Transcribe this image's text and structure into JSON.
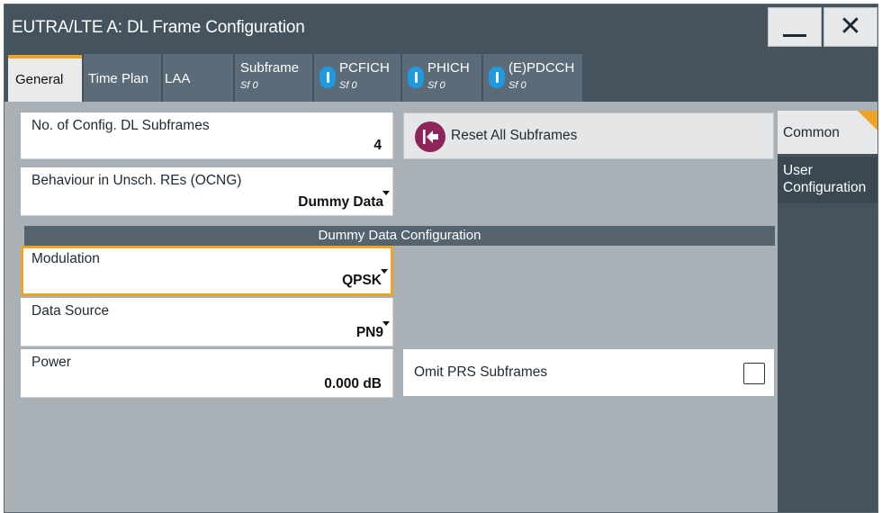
{
  "window": {
    "title": "EUTRA/LTE A: DL Frame Configuration",
    "minimize_icon": "minimize-icon",
    "close_icon": "close-icon"
  },
  "tabs": [
    {
      "label": "General",
      "sub": "",
      "info": false,
      "active": true
    },
    {
      "label": "Time Plan",
      "sub": "",
      "info": false,
      "active": false
    },
    {
      "label": "LAA",
      "sub": "",
      "info": false,
      "active": false
    },
    {
      "label": "Subframe",
      "sub": "Sf 0",
      "info": false,
      "active": false
    },
    {
      "label": "PCFICH",
      "sub": "Sf 0",
      "info": true,
      "active": false
    },
    {
      "label": "PHICH",
      "sub": "Sf 0",
      "info": true,
      "active": false
    },
    {
      "label": "(E)PDCCH",
      "sub": "Sf 0",
      "info": true,
      "active": false
    }
  ],
  "fields": {
    "num_subframes": {
      "label": "No. of Config. DL Subframes",
      "value": "4"
    },
    "behaviour": {
      "label": "Behaviour in Unsch. REs (OCNG)",
      "value": "Dummy Data"
    },
    "modulation": {
      "label": "Modulation",
      "value": "QPSK"
    },
    "data_source": {
      "label": "Data Source",
      "value": "PN9"
    },
    "power": {
      "label": "Power",
      "value": "0.000 dB"
    }
  },
  "reset_button": {
    "label": "Reset All Subframes",
    "icon": "reset-arrow-icon"
  },
  "section": {
    "title": "Dummy Data Configuration"
  },
  "omit_prs": {
    "label": "Omit PRS Subframes",
    "checked": false
  },
  "side_panel": {
    "common": "Common",
    "user_line1": "User",
    "user_line2": "Configuration"
  },
  "colors": {
    "accent": "#f0a225",
    "titlebar": "#44535e",
    "info": "#1e9be0",
    "reset_icon": "#8e2459"
  }
}
